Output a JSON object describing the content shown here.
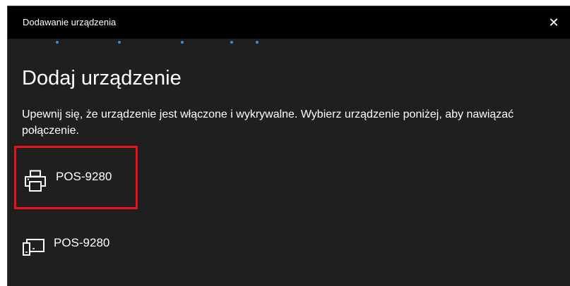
{
  "window": {
    "title": "Dodawanie urządzenia",
    "close_glyph": "✕"
  },
  "progress": {
    "state": "indeterminate",
    "color": "#2f8fe8"
  },
  "main": {
    "heading": "Dodaj urządzenie",
    "description": "Upewnij się, że urządzenie jest włączone i wykrywalne. Wybierz urządzenie poniżej, aby nawiązać połączenie."
  },
  "devices": [
    {
      "name": "POS-9280",
      "icon": "printer-icon",
      "selected": true
    },
    {
      "name": "POS-9280",
      "icon": "device-icon",
      "selected": false
    }
  ],
  "colors": {
    "titlebar": "#000000",
    "background": "#1f1f1f",
    "text": "#ffffff",
    "highlight": "#e8121a"
  }
}
